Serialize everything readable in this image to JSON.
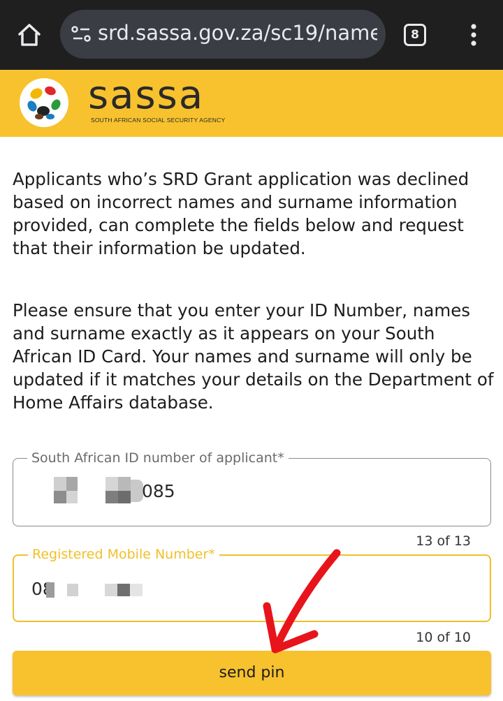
{
  "browser": {
    "url": "srd.sassa.gov.za/sc19/name",
    "tab_count": "8",
    "icons": [
      "home-icon",
      "site-info-icon",
      "tab-switcher-icon",
      "more-vert-icon"
    ]
  },
  "header": {
    "brand_name": "sassa",
    "brand_tagline": "SOUTH AFRICAN SOCIAL SECURITY AGENCY",
    "accent_color": "#f7c22e"
  },
  "main": {
    "paragraph_1": "Applicants who’s SRD Grant application was declined based on incorrect names and surname information provided, can complete the fields below and request that their information be updated.",
    "paragraph_2": "Please ensure that you enter your ID Number, names and surname exactly as it appears on your South African ID Card. Your names and surname will only be updated if it matches your details on the Department of Home Affairs database."
  },
  "form": {
    "id_field": {
      "label": "South African ID number of applicant*",
      "visible_value_suffix": "085",
      "counter": "13 of 13"
    },
    "mobile_field": {
      "label": "Registered Mobile Number*",
      "visible_value_prefix": "08",
      "counter": "10 of 10",
      "focus_color": "#f0c02a"
    },
    "submit_label": "send pin"
  },
  "annotation": {
    "color": "#e8141b"
  }
}
